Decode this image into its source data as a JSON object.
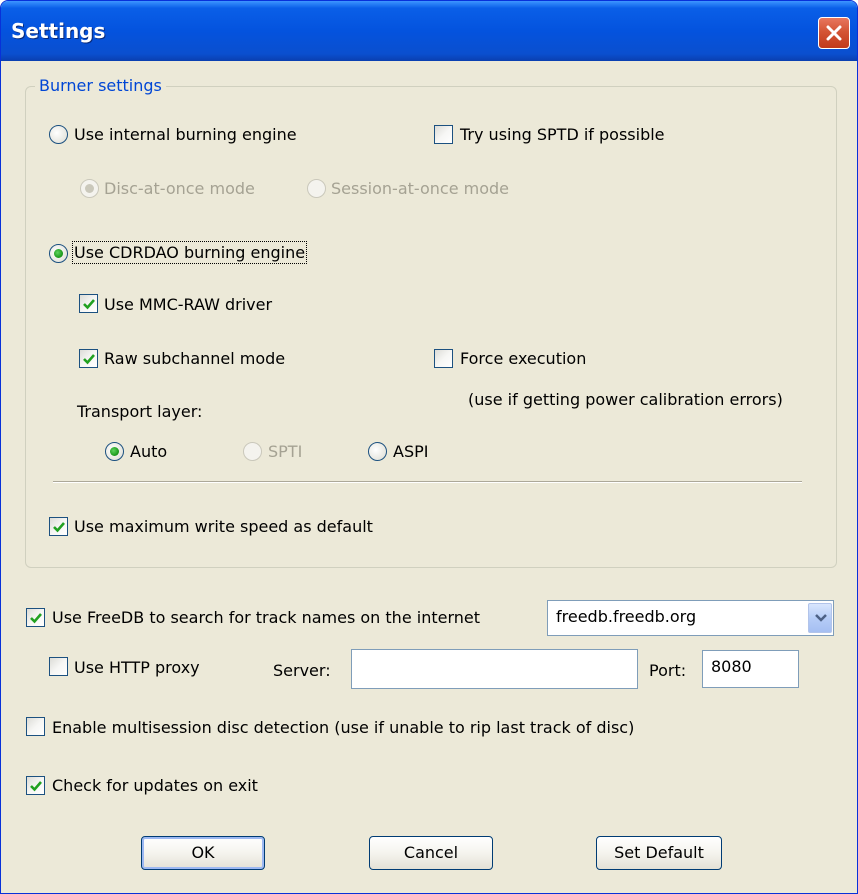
{
  "window": {
    "title": "Settings"
  },
  "burner_settings": {
    "group_label": "Burner settings",
    "internal_engine_label": "Use internal burning engine",
    "internal_engine_selected": false,
    "sptd_label": "Try using SPTD if possible",
    "sptd_checked": false,
    "disc_at_once_label": "Disc-at-once mode",
    "disc_at_once_selected": true,
    "session_at_once_label": "Session-at-once mode",
    "session_at_once_selected": false,
    "cdrdao_engine_label": "Use CDRDAO burning engine",
    "cdrdao_engine_selected": true,
    "mmc_raw_label": "Use MMC-RAW driver",
    "mmc_raw_checked": true,
    "raw_subchannel_label": "Raw subchannel mode",
    "raw_subchannel_checked": true,
    "force_execution_label": "Force execution",
    "force_execution_checked": false,
    "force_execution_note": "(use if getting power calibration errors)",
    "transport_layer_label": "Transport layer:",
    "transport_options": [
      {
        "label": "Auto",
        "selected": true,
        "enabled": true
      },
      {
        "label": "SPTI",
        "selected": false,
        "enabled": false
      },
      {
        "label": "ASPI",
        "selected": false,
        "enabled": true
      }
    ],
    "max_write_speed_label": "Use maximum write speed as default",
    "max_write_speed_checked": true
  },
  "freedb": {
    "label": "Use FreeDB to search for track names on the internet",
    "checked": true,
    "server_value": "freedb.freedb.org"
  },
  "proxy": {
    "label": "Use HTTP proxy",
    "checked": false,
    "server_label": "Server:",
    "server_value": "",
    "port_label": "Port:",
    "port_value": "8080"
  },
  "multisession": {
    "label": "Enable multisession disc detection (use if unable to rip last track of disc)",
    "checked": false
  },
  "updates": {
    "label": "Check for updates on exit",
    "checked": true
  },
  "buttons": {
    "ok": "OK",
    "cancel": "Cancel",
    "set_default": "Set Default"
  },
  "colors": {
    "title_bar": "#0453de",
    "group_label": "#0046d5",
    "radio_dot": "#219e21",
    "check_mark": "#21a121",
    "close_button": "#d45535",
    "dialog_face": "#ece9d8"
  }
}
